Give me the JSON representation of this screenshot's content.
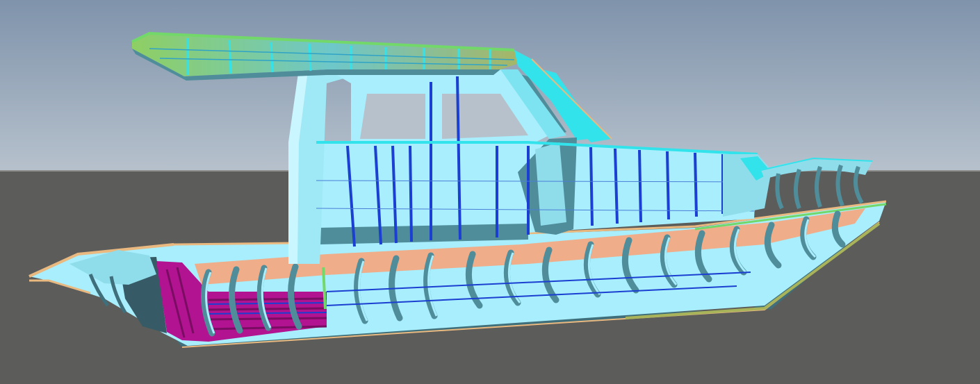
{
  "scene": {
    "colors": {
      "sky_top": "#7f93ab",
      "sky_bottom": "#b6c1cc",
      "ground": "#5c5c5a",
      "horizon": "#8e8f8d",
      "hull_light": "#a8eefc",
      "hull_mid": "#8fdcea",
      "hull_shade": "#4f8d9b",
      "frame_cyan": "#33e3ec",
      "frame_blue": "#1a3fd1",
      "accent_green": "#73d86a",
      "olive": "#a8b35a",
      "salmon": "#f0ad8a",
      "magenta": "#b21390",
      "magenta_dark": "#7a0c63",
      "edge_orange": "#e9b980"
    },
    "grid": {
      "front_frames": 11,
      "hull_ribs": 18,
      "foredeck_ribs": 6
    }
  }
}
